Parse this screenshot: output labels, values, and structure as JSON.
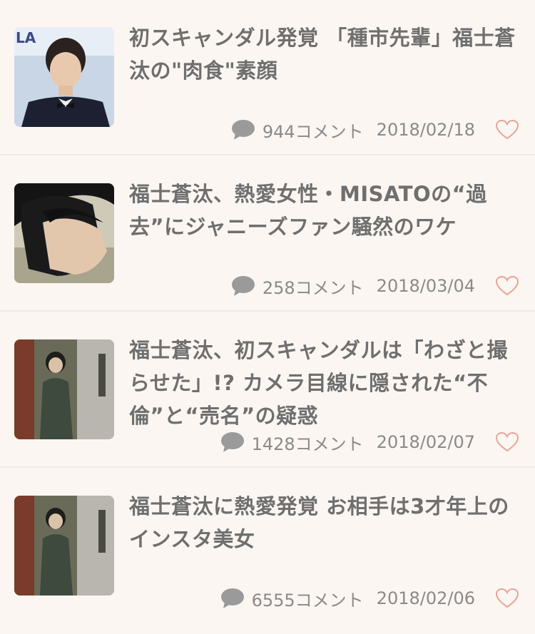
{
  "articles": [
    {
      "title": "初スキャンダル発覚 「種市先輩」福士蒼汰の\"肉食\"素顔",
      "comments": "944コメント",
      "date": "2018/02/18",
      "thumbnail": "man-in-tuxedo-smiling"
    },
    {
      "title": "福士蒼汰、熱愛女性・MISATOの“過去”にジャニーズファン騒然のワケ",
      "comments": "258コメント",
      "date": "2018/03/04",
      "thumbnail": "man-profile-closeup"
    },
    {
      "title": "福士蒼汰、初スキャンダルは「わざと撮らせた」!? カメラ目線に隠された“不倫”と“売名”の疑惑",
      "comments": "1428コメント",
      "date": "2018/02/07",
      "thumbnail": "woman-at-doorway-night"
    },
    {
      "title": "福士蒼汰に熱愛発覚 お相手は3才年上のインスタ美女",
      "comments": "6555コメント",
      "date": "2018/02/06",
      "thumbnail": "woman-at-doorway-night"
    }
  ],
  "colors": {
    "background": "#fbf6f2",
    "title_text": "#6f6f6f",
    "meta_text": "#8a8a8a",
    "heart_outline": "#e7a497",
    "comment_icon": "#9a9a9a"
  }
}
